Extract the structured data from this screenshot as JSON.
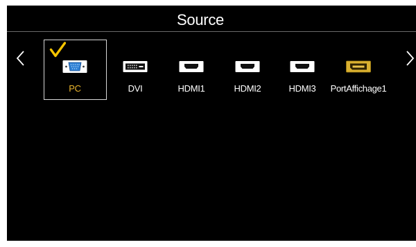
{
  "header": {
    "title": "Source"
  },
  "navigation": {
    "prev_icon": "chevron-left-icon",
    "next_icon": "chevron-right-icon"
  },
  "selection_marker": {
    "icon": "checkmark-icon"
  },
  "sources": [
    {
      "label": "PC",
      "icon": "vga-connector-icon",
      "selected": true
    },
    {
      "label": "DVI",
      "icon": "dvi-connector-icon",
      "selected": false
    },
    {
      "label": "HDMI1",
      "icon": "hdmi-connector-icon",
      "selected": false
    },
    {
      "label": "HDMI2",
      "icon": "hdmi-connector-icon",
      "selected": false
    },
    {
      "label": "HDMI3",
      "icon": "hdmi-connector-icon",
      "selected": false
    },
    {
      "label": "PortAffichage1",
      "icon": "displayport-connector-icon",
      "selected": false
    }
  ],
  "colors": {
    "background": "#000000",
    "text": "#ffffff",
    "selected_label": "#ebb52c",
    "checkmark": "#f5c400",
    "selection_border": "#d8d8d8",
    "displayport_icon": "#d9b030"
  }
}
